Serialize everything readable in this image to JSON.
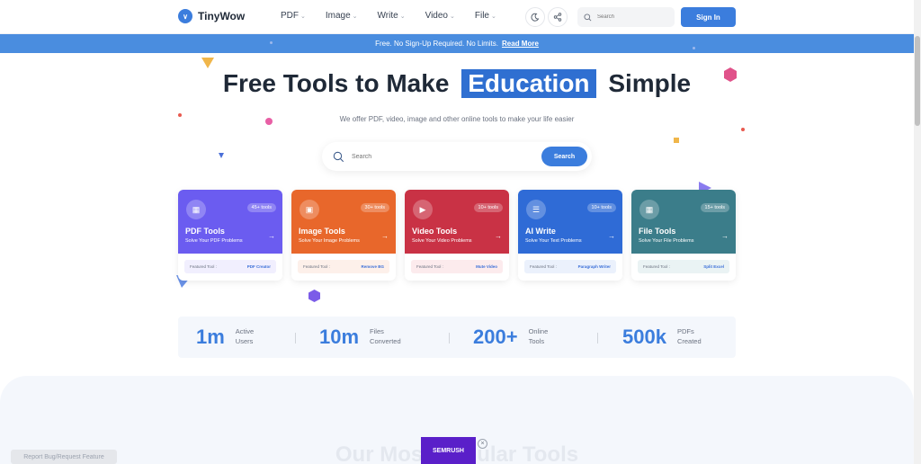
{
  "header": {
    "brand": "TinyWow",
    "nav": [
      {
        "label": "PDF"
      },
      {
        "label": "Image"
      },
      {
        "label": "Write"
      },
      {
        "label": "Video"
      },
      {
        "label": "File"
      }
    ],
    "search_placeholder": "Search",
    "signin_label": "Sign In"
  },
  "banner": {
    "text": "Free. No Sign-Up Required. No Limits.",
    "link": "Read More"
  },
  "hero": {
    "title_before": "Free Tools to Make",
    "title_highlight": "Education",
    "title_after": "Simple",
    "subtitle": "We offer PDF, video, image and other online tools to make your life easier",
    "search_placeholder": "Search",
    "search_button": "Search"
  },
  "cards": [
    {
      "title": "PDF Tools",
      "desc": "Solve Your PDF Problems",
      "badge": "45+ tools",
      "featured_label": "Featured Tool :",
      "featured_tool": "PDF Creator",
      "color": "#6b5cf0"
    },
    {
      "title": "Image Tools",
      "desc": "Solve Your Image Problems",
      "badge": "30+ tools",
      "featured_label": "Featured Tool :",
      "featured_tool": "Remove BG",
      "color": "#e8672b"
    },
    {
      "title": "Video Tools",
      "desc": "Solve Your Video Problems",
      "badge": "10+ tools",
      "featured_label": "Featured Tool :",
      "featured_tool": "Mute Video",
      "color": "#c93245"
    },
    {
      "title": "AI Write",
      "desc": "Solve Your Text Problems",
      "badge": "10+ tools",
      "featured_label": "Featured Tool :",
      "featured_tool": "Paragraph Writer",
      "color": "#2f6bd6"
    },
    {
      "title": "File Tools",
      "desc": "Solve Your File Problems",
      "badge": "15+ tools",
      "featured_label": "Featured Tool :",
      "featured_tool": "Split Excel",
      "color": "#3b7d8a"
    }
  ],
  "stats": [
    {
      "value": "1m",
      "label1": "Active",
      "label2": "Users"
    },
    {
      "value": "10m",
      "label1": "Files",
      "label2": "Converted"
    },
    {
      "value": "200+",
      "label1": "Online",
      "label2": "Tools"
    },
    {
      "value": "500k",
      "label1": "PDFs",
      "label2": "Created"
    }
  ],
  "section_title": "Our Most Popular Tools",
  "report_label": "Report Bug/Request Feature",
  "ad_text": "SEMRUSH",
  "colors": {
    "accent": "#3b7ddd",
    "banner": "#4a8ddf"
  }
}
